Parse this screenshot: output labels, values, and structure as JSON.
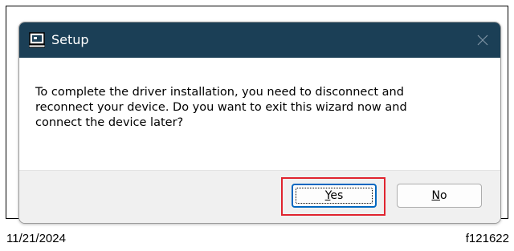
{
  "dialog": {
    "title": "Setup",
    "icon": "setup-app-icon",
    "close_icon": "close-icon",
    "message": "To complete the driver installation, you need to disconnect and\nreconnect your device. Do you want to exit this wizard now and\nconnect the device later?",
    "buttons": {
      "yes_mnemonic": "Y",
      "yes_rest": "es",
      "no_mnemonic": "N",
      "no_rest": "o"
    }
  },
  "caption": {
    "date": "11/21/2024",
    "figure_id": "f121622"
  },
  "colors": {
    "titlebar": "#1b3f56",
    "highlight": "#e0242f",
    "default_button_border": "#0067c0",
    "footer": "#f0f0f0"
  }
}
